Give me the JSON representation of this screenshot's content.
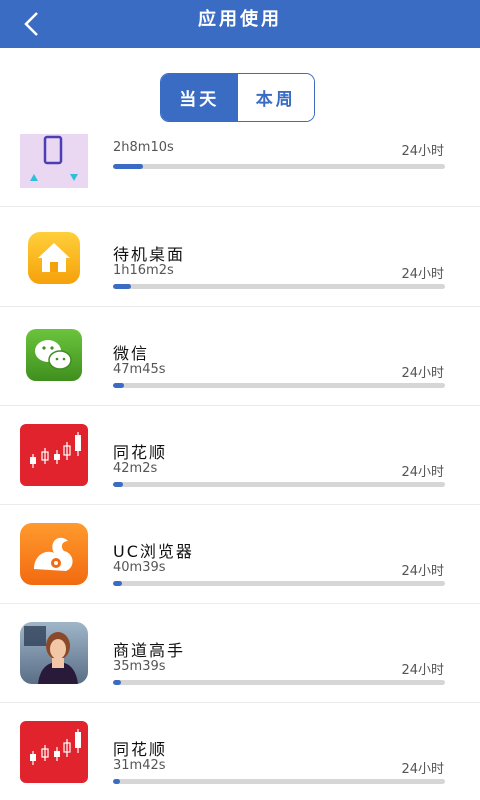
{
  "header": {
    "title": "应用使用",
    "back_icon": "back-chevron-icon"
  },
  "tabs": [
    {
      "label": "当天",
      "active": true
    },
    {
      "label": "本周",
      "active": false
    }
  ],
  "colors": {
    "accent": "#3b6cc4",
    "track": "#d6d6d6"
  },
  "apps": [
    {
      "name": "",
      "time": "2h8m10s",
      "max": "24小时",
      "fraction": 0.089,
      "icon": "phone-manager-icon"
    },
    {
      "name": "待机桌面",
      "time": "1h16m2s",
      "max": "24小时",
      "fraction": 0.053,
      "icon": "home-launcher-icon"
    },
    {
      "name": "微信",
      "time": "47m45s",
      "max": "24小时",
      "fraction": 0.033,
      "icon": "wechat-icon"
    },
    {
      "name": "同花顺",
      "time": "42m2s",
      "max": "24小时",
      "fraction": 0.029,
      "icon": "tonghuashun-icon"
    },
    {
      "name": "UC浏览器",
      "time": "40m39s",
      "max": "24小时",
      "fraction": 0.028,
      "icon": "uc-browser-icon"
    },
    {
      "name": "商道高手",
      "time": "35m39s",
      "max": "24小时",
      "fraction": 0.025,
      "icon": "shangdao-game-icon"
    },
    {
      "name": "同花顺",
      "time": "31m42s",
      "max": "24小时",
      "fraction": 0.022,
      "icon": "tonghuashun-icon"
    }
  ]
}
